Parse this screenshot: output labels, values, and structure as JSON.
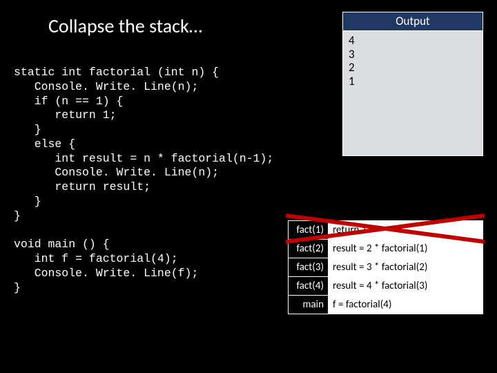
{
  "title": "Collapse the stack…",
  "code": "static int factorial (int n) {\n   Console. Write. Line(n);\n   if (n == 1) {\n      return 1;\n   }\n   else {\n      int result = n * factorial(n-1);\n      Console. Write. Line(n);\n      return result;\n   }\n}\n\nvoid main () {\n   int f = factorial(4);\n   Console. Write. Line(f);\n}",
  "output": {
    "header": "Output",
    "lines": [
      "4",
      "3",
      "2",
      "1"
    ]
  },
  "stack": [
    {
      "label": "fact(1)",
      "expr": "return 1"
    },
    {
      "label": "fact(2)",
      "expr": "result = 2 * factorial(1)"
    },
    {
      "label": "fact(3)",
      "expr": "result = 3 * factorial(2)"
    },
    {
      "label": "fact(4)",
      "expr": "result = 4 * factorial(3)"
    },
    {
      "label": "main",
      "expr": "f = factorial(4)"
    }
  ],
  "colors": {
    "crossed": "#c00000"
  }
}
